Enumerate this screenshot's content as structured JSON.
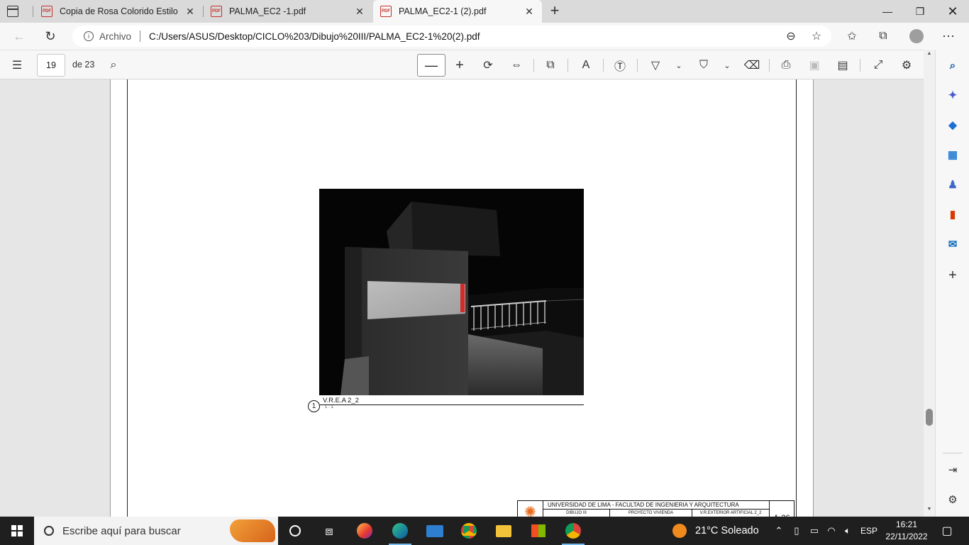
{
  "tabs": [
    {
      "label": "Copia de Rosa Colorido Estilo Se",
      "icon": "pdf-icon"
    },
    {
      "label": "PALMA_EC2 -1.pdf",
      "icon": "pdf-icon"
    },
    {
      "label": "PALMA_EC2-1 (2).pdf",
      "icon": "pdf-icon",
      "active": true
    }
  ],
  "tab_pdf_badge": "PDF",
  "address": {
    "protocol_label": "Archivo",
    "url": "C:/Users/ASUS/Desktop/CICLO%203/Dibujo%20III/PALMA_EC2-1%20(2).pdf"
  },
  "pdf_toolbar": {
    "page_current": "19",
    "page_total_label": "de 23"
  },
  "drawing": {
    "caption_number": "1",
    "caption_title": "V.R.E.A 2_2",
    "caption_scale": "1 : 1"
  },
  "title_block": {
    "header": "UNIVERSIDAD DE LIMA - FACULTAD DE INGENIERIA Y ARQUITECTURA",
    "course": "DIBUJO III",
    "project": "PROYECTO VIVIENDA",
    "sheet_name": "V.R.EXTERIOR ARTIFICIAL 2_2",
    "sheet_code": "A-26"
  },
  "taskbar": {
    "search_placeholder": "Escribe aquí para buscar",
    "weather": "21°C  Soleado",
    "language": "ESP",
    "time": "16:21",
    "date": "22/11/2022"
  },
  "colors": {
    "pdf_red": "#c4302b",
    "edge_blue": "#0c59a4",
    "taskbar_bg": "#1f1f1f",
    "active_indicator": "#76b9ed"
  }
}
